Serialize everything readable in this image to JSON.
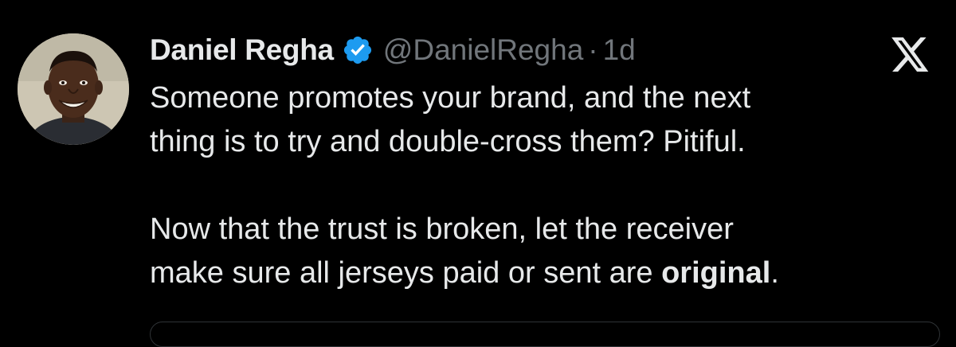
{
  "tweet": {
    "author": {
      "display_name": "Daniel Regha",
      "verified": true,
      "handle": "@DanielRegha",
      "separator": "·",
      "time": "1d"
    },
    "text": {
      "paragraph1_line1": "Someone promotes your brand, and the next",
      "paragraph1_line2": "thing is to try and double-cross them? Pitiful.",
      "paragraph2_line1": "Now that the trust is broken, let the receiver",
      "paragraph2_line2_before": "make sure all jerseys paid or sent are ",
      "paragraph2_line2_bold": "original",
      "paragraph2_line2_after": "."
    }
  },
  "icons": {
    "verified": "verified-badge-icon",
    "platform": "x-logo-icon"
  },
  "colors": {
    "background": "#000000",
    "primary_text": "#e7e9ea",
    "secondary_text": "#71767b",
    "verified_blue": "#1d9bf0"
  }
}
